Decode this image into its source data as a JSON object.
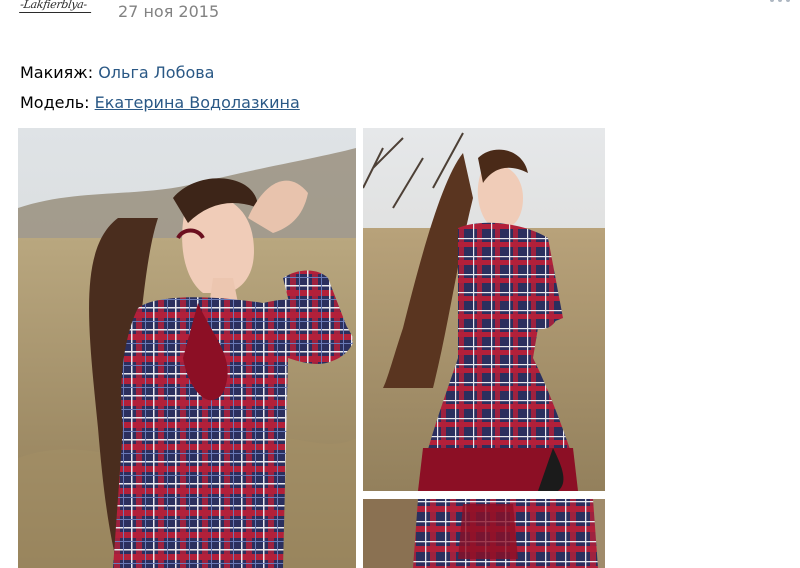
{
  "post": {
    "author_logo_text": "-Lakfierblya-",
    "date": "27 ноя 2015"
  },
  "credits": [
    {
      "label": "Макияж:",
      "name": "Ольга Лобова",
      "underlined": false
    },
    {
      "label": "Модель:",
      "name": "Екатерина Водолазкина",
      "underlined": true
    }
  ],
  "photos": [
    {
      "id": "photo-1",
      "alt": "model in plaid dress in field"
    },
    {
      "id": "photo-2",
      "alt": "model in plaid dress looking back"
    },
    {
      "id": "photo-3",
      "alt": "plaid dress detail"
    }
  ],
  "icons": {
    "more": "more-dots-icon"
  },
  "colors": {
    "link": "#2a5885",
    "date": "#828282",
    "dots": "#aeb7c2"
  }
}
